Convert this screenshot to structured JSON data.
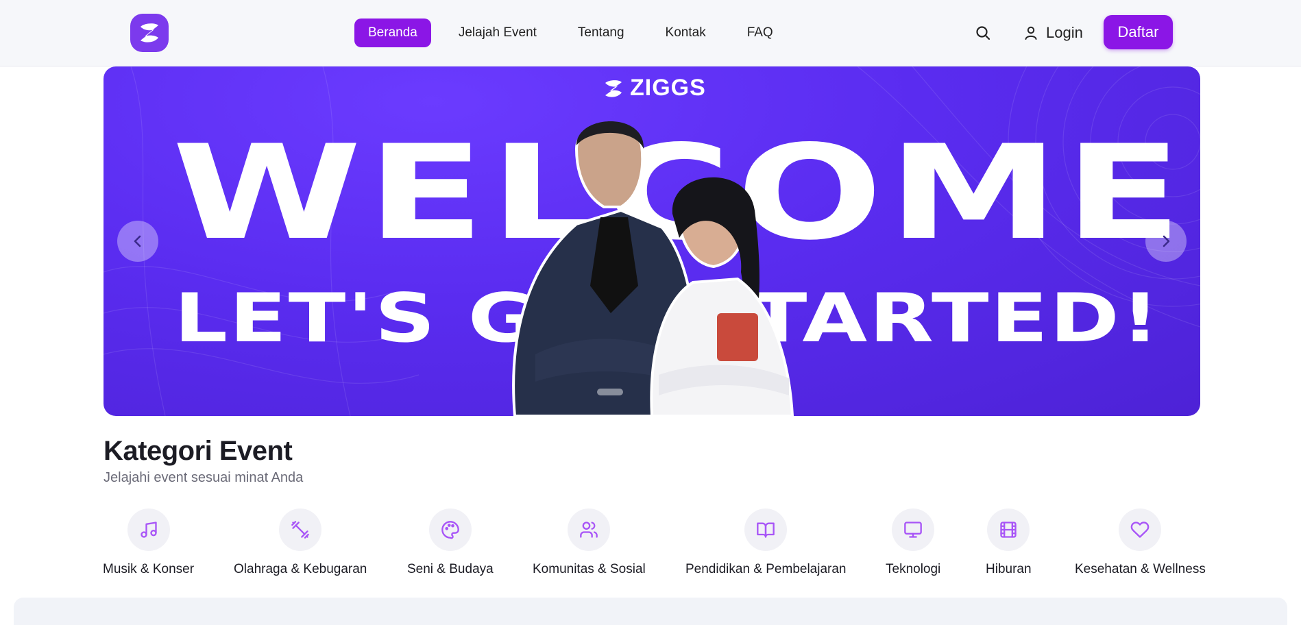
{
  "header": {
    "nav": [
      "Beranda",
      "Jelajah Event",
      "Tentang",
      "Kontak",
      "FAQ"
    ],
    "active_nav": "Beranda",
    "login_label": "Login",
    "register_label": "Daftar"
  },
  "hero": {
    "brand": "ZIGGS",
    "line1": "WELCOME",
    "line2": "LET'S GET STARTED!"
  },
  "category": {
    "title": "Kategori Event",
    "subtitle": "Jelajahi event sesuai minat Anda",
    "items": [
      {
        "label": "Musik & Konser",
        "icon": "music-icon"
      },
      {
        "label": "Olahraga & Kebugaran",
        "icon": "dumbbell-icon"
      },
      {
        "label": "Seni & Budaya",
        "icon": "palette-icon"
      },
      {
        "label": "Komunitas & Sosial",
        "icon": "users-icon"
      },
      {
        "label": "Pendidikan & Pembelajaran",
        "icon": "book-icon"
      },
      {
        "label": "Teknologi",
        "icon": "monitor-icon"
      },
      {
        "label": "Hiburan",
        "icon": "film-icon"
      },
      {
        "label": "Kesehatan & Wellness",
        "icon": "heart-icon"
      }
    ]
  },
  "colors": {
    "accent": "#8b16e6",
    "hero_bg": "#5a2cf0",
    "icon_accent": "#a855f7"
  }
}
